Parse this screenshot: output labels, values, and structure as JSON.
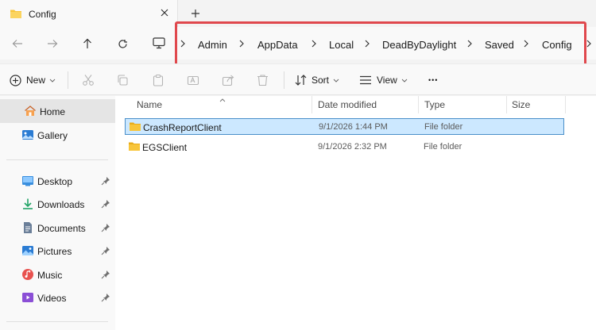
{
  "tab": {
    "title": "Config",
    "close_glyph": "✕",
    "new_glyph": "+"
  },
  "breadcrumb": [
    "Admin",
    "AppData",
    "Local",
    "DeadByDaylight",
    "Saved",
    "Config"
  ],
  "toolbar": {
    "new_label": "New",
    "sort_label": "Sort",
    "view_label": "View",
    "more_glyph": "•••"
  },
  "sidebar": {
    "items": [
      {
        "label": "Home",
        "icon": "home-icon",
        "pinned": false
      },
      {
        "label": "Gallery",
        "icon": "gallery-icon",
        "pinned": false
      },
      {
        "label": "Desktop",
        "icon": "desktop-icon",
        "pinned": true
      },
      {
        "label": "Downloads",
        "icon": "downloads-icon",
        "pinned": true
      },
      {
        "label": "Documents",
        "icon": "documents-icon",
        "pinned": true
      },
      {
        "label": "Pictures",
        "icon": "pictures-icon",
        "pinned": true
      },
      {
        "label": "Music",
        "icon": "music-icon",
        "pinned": true
      },
      {
        "label": "Videos",
        "icon": "videos-icon",
        "pinned": true
      }
    ]
  },
  "columns": {
    "name": "Name",
    "date": "Date modified",
    "type": "Type",
    "size": "Size"
  },
  "files": [
    {
      "name": "CrashReportClient",
      "date": "9/1/2026 1:44 PM",
      "type": "File folder",
      "selected": true
    },
    {
      "name": "EGSClient",
      "date": "9/1/2026 2:32 PM",
      "type": "File folder",
      "selected": false
    }
  ],
  "colors": {
    "highlight": "#e0484d",
    "selection_fill": "#cce8ff",
    "selection_border": "#4a8fc9",
    "folder": "#f8c53a",
    "accent_blue": "#2b7cd3"
  }
}
